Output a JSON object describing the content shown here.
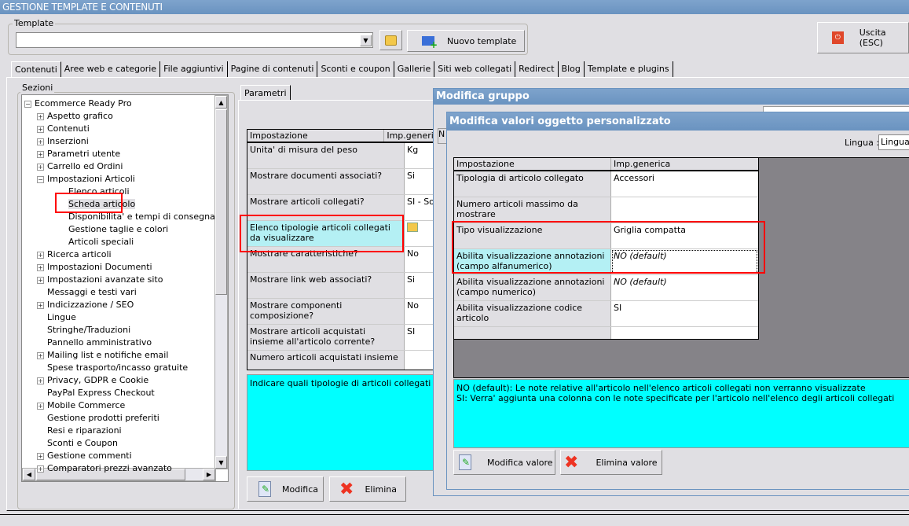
{
  "app": {
    "title": "GESTIONE TEMPLATE E CONTENUTI"
  },
  "template": {
    "legend": "Template",
    "value": "",
    "new_button": "Nuovo template"
  },
  "exit_button": "Uscita (ESC)",
  "tabs": [
    "Contenuti",
    "Aree web e categorie",
    "File aggiuntivi",
    "Pagine di contenuti",
    "Sconti e coupon",
    "Gallerie",
    "Siti web collegati",
    "Redirect",
    "Blog",
    "Template e plugins"
  ],
  "sections": {
    "legend": "Sezioni",
    "root": "Ecommerce Ready Pro",
    "items": [
      {
        "label": "Aspetto grafico",
        "level": 1,
        "expander": "+"
      },
      {
        "label": "Contenuti",
        "level": 1,
        "expander": "+"
      },
      {
        "label": "Inserzioni",
        "level": 1,
        "expander": "+"
      },
      {
        "label": "Parametri utente",
        "level": 1,
        "expander": "+"
      },
      {
        "label": "Carrello ed Ordini",
        "level": 1,
        "expander": "+"
      },
      {
        "label": "Impostazioni Articoli",
        "level": 1,
        "expander": "-"
      },
      {
        "label": "Elenco articoli",
        "level": 2,
        "expander": ""
      },
      {
        "label": "Scheda articolo",
        "level": 2,
        "expander": "",
        "selected": true
      },
      {
        "label": "Disponibilita' e tempi di consegna",
        "level": 2,
        "expander": ""
      },
      {
        "label": "Gestione taglie e colori",
        "level": 2,
        "expander": ""
      },
      {
        "label": "Articoli speciali",
        "level": 2,
        "expander": ""
      },
      {
        "label": "Ricerca articoli",
        "level": 1,
        "expander": "+"
      },
      {
        "label": "Impostazioni Documenti",
        "level": 1,
        "expander": "+"
      },
      {
        "label": "Impostazioni avanzate sito",
        "level": 1,
        "expander": "+"
      },
      {
        "label": "Messaggi e testi vari",
        "level": 1,
        "expander": ""
      },
      {
        "label": "Indicizzazione / SEO",
        "level": 1,
        "expander": "+"
      },
      {
        "label": "Lingue",
        "level": 1,
        "expander": ""
      },
      {
        "label": "Stringhe/Traduzioni",
        "level": 1,
        "expander": ""
      },
      {
        "label": "Pannello amministrativo",
        "level": 1,
        "expander": ""
      },
      {
        "label": "Mailing list e notifiche email",
        "level": 1,
        "expander": "+"
      },
      {
        "label": "Spese trasporto/incasso gratuite",
        "level": 1,
        "expander": ""
      },
      {
        "label": "Privacy, GDPR e Cookie",
        "level": 1,
        "expander": "+"
      },
      {
        "label": "PayPal Express Checkout",
        "level": 1,
        "expander": ""
      },
      {
        "label": "Mobile Commerce",
        "level": 1,
        "expander": "+"
      },
      {
        "label": "Gestione prodotti preferiti",
        "level": 1,
        "expander": ""
      },
      {
        "label": "Resi e riparazioni",
        "level": 1,
        "expander": ""
      },
      {
        "label": "Sconti e Coupon",
        "level": 1,
        "expander": ""
      },
      {
        "label": "Gestione commenti",
        "level": 1,
        "expander": "+"
      },
      {
        "label": "Comparatori prezzi avanzato",
        "level": 1,
        "expander": "+"
      }
    ]
  },
  "params": {
    "tab": "Parametri",
    "headers": [
      "Impostazione",
      "Imp.generica"
    ],
    "rows": [
      {
        "name": "Unita' di misura del peso",
        "value": "Kg"
      },
      {
        "name": "Mostrare documenti associati?",
        "value": "Si"
      },
      {
        "name": "Mostrare articoli collegati?",
        "value": "SI - Solo tipologi"
      },
      {
        "name": "Elenco tipologie articoli collegati da visualizzare",
        "value": "",
        "selected": true
      },
      {
        "name": "Mostrare caratteristiche?",
        "value": "No"
      },
      {
        "name": "Mostrare link web associati?",
        "value": "Si"
      },
      {
        "name": "Mostrare componenti composizione?",
        "value": "No"
      },
      {
        "name": "Mostrare articoli acquistati insieme all'articolo corrente?",
        "value": "SI"
      },
      {
        "name": "Numero articoli acquistati insieme",
        "value": ""
      }
    ],
    "description": "Indicare quali tipologie di articoli collegati si voglio",
    "edit_button": "Modifica",
    "delete_button": "Elimina"
  },
  "group_window": {
    "title": "Modifica gruppo",
    "partial_label": "N"
  },
  "values_window": {
    "title": "Modifica valori oggetto personalizzato",
    "language_label": "Lingua :",
    "language_value": "Lingua",
    "headers": [
      "Impostazione",
      "Imp.generica"
    ],
    "rows": [
      {
        "name": "Tipologia di articolo collegato",
        "value": "Accessori"
      },
      {
        "name": "Numero articoli massimo da mostrare",
        "value": ""
      },
      {
        "name": "Tipo visualizzazione",
        "value": "Griglia compatta"
      },
      {
        "name": "Abilita visualizzazione annotazioni (campo alfanumerico)",
        "value": "NO (default)",
        "selected": true,
        "italic": true
      },
      {
        "name": "Abilita visualizzazione annotazioni (campo numerico)",
        "value": "NO (default)",
        "italic": true
      },
      {
        "name": "Abilita visualizzazione codice articolo",
        "value": "SI"
      },
      {
        "name": "",
        "value": ""
      }
    ],
    "description_lines": [
      "NO (default): Le note relative all'articolo nell'elenco articoli collegati non verranno visualizzate",
      "SI: Verra' aggiunta una colonna con le note specificate per l'articolo nell'elenco degli articoli collegati"
    ],
    "edit_button": "Modifica valore",
    "delete_button": "Elimina valore"
  },
  "colors": {
    "titlebar": "#6a93c0",
    "description_bg": "#00ffff",
    "selected_row": "#b4f0f4",
    "highlight": "#ff0000"
  }
}
